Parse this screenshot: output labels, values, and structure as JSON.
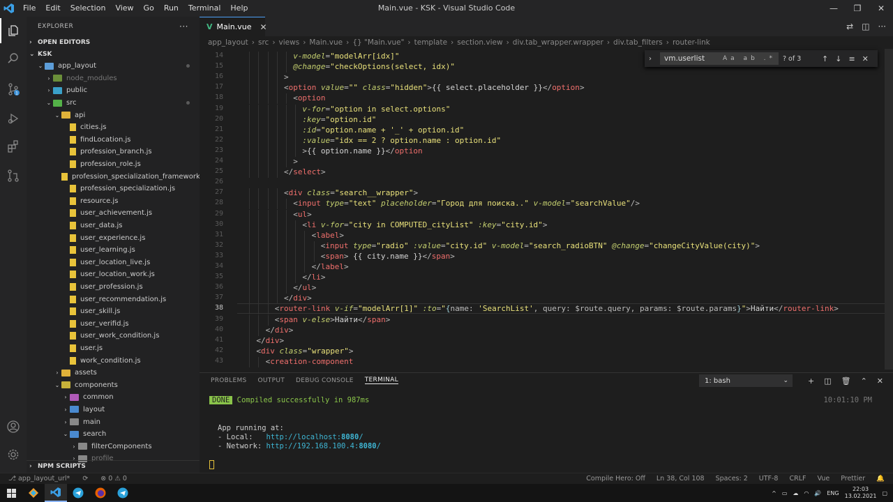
{
  "titlebar": {
    "menu": [
      "File",
      "Edit",
      "Selection",
      "View",
      "Go",
      "Run",
      "Terminal",
      "Help"
    ],
    "title": "Main.vue - KSK - Visual Studio Code"
  },
  "sidebar": {
    "header": "EXPLORER",
    "more": "···",
    "open_editors": "OPEN EDITORS",
    "project": "KSK",
    "npm_scripts": "NPM SCRIPTS",
    "tree": [
      {
        "label": "app_layout",
        "depth": 1,
        "type": "folder-open",
        "color": "#5d9dd8",
        "dot": true
      },
      {
        "label": "node_modules",
        "depth": 2,
        "type": "folder",
        "color": "#6b8f3a",
        "dim": true
      },
      {
        "label": "public",
        "depth": 2,
        "type": "folder",
        "color": "#3aa0c8"
      },
      {
        "label": "src",
        "depth": 2,
        "type": "folder-open",
        "color": "#54b248",
        "dot": true
      },
      {
        "label": "api",
        "depth": 3,
        "type": "folder-open",
        "color": "#e0b23a"
      },
      {
        "label": "cities.js",
        "depth": 4,
        "type": "js"
      },
      {
        "label": "findLocation.js",
        "depth": 4,
        "type": "js"
      },
      {
        "label": "profession_branch.js",
        "depth": 4,
        "type": "js"
      },
      {
        "label": "profession_role.js",
        "depth": 4,
        "type": "js"
      },
      {
        "label": "profession_specialization_framework.js",
        "depth": 4,
        "type": "js"
      },
      {
        "label": "profession_specialization.js",
        "depth": 4,
        "type": "js"
      },
      {
        "label": "resource.js",
        "depth": 4,
        "type": "js"
      },
      {
        "label": "user_achievement.js",
        "depth": 4,
        "type": "js"
      },
      {
        "label": "user_data.js",
        "depth": 4,
        "type": "js"
      },
      {
        "label": "user_experience.js",
        "depth": 4,
        "type": "js"
      },
      {
        "label": "user_learning.js",
        "depth": 4,
        "type": "js"
      },
      {
        "label": "user_location_live.js",
        "depth": 4,
        "type": "js"
      },
      {
        "label": "user_location_work.js",
        "depth": 4,
        "type": "js"
      },
      {
        "label": "user_profession.js",
        "depth": 4,
        "type": "js"
      },
      {
        "label": "user_recommendation.js",
        "depth": 4,
        "type": "js"
      },
      {
        "label": "user_skill.js",
        "depth": 4,
        "type": "js"
      },
      {
        "label": "user_verifid.js",
        "depth": 4,
        "type": "js"
      },
      {
        "label": "user_work_condition.js",
        "depth": 4,
        "type": "js"
      },
      {
        "label": "user.js",
        "depth": 4,
        "type": "js"
      },
      {
        "label": "work_condition.js",
        "depth": 4,
        "type": "js"
      },
      {
        "label": "assets",
        "depth": 3,
        "type": "folder",
        "color": "#e0b23a"
      },
      {
        "label": "components",
        "depth": 3,
        "type": "folder-open",
        "color": "#c7b23a"
      },
      {
        "label": "common",
        "depth": 4,
        "type": "folder",
        "color": "#b05ab8"
      },
      {
        "label": "layout",
        "depth": 4,
        "type": "folder",
        "color": "#4a8ad0"
      },
      {
        "label": "main",
        "depth": 4,
        "type": "folder",
        "color": "#888"
      },
      {
        "label": "search",
        "depth": 4,
        "type": "folder-open",
        "color": "#4a8ad0"
      },
      {
        "label": "filterComponents",
        "depth": 5,
        "type": "folder",
        "color": "#888"
      },
      {
        "label": "profile",
        "depth": 5,
        "type": "folder",
        "color": "#888",
        "dim": true
      }
    ]
  },
  "tab": {
    "label": "Main.vue",
    "close": "✕"
  },
  "breadcrumb": [
    "app_layout",
    "src",
    "views",
    "Main.vue",
    "{} \"Main.vue\"",
    "template",
    "section.view",
    "div.tab_wrapper.wrapper",
    "div.tab_filters",
    "router-link"
  ],
  "find": {
    "query": "vm.userlist",
    "count": "? of 3",
    "options": "Aa ab .*"
  },
  "code": {
    "current_line": "38",
    "lines": [
      {
        "n": "14",
        "indent": 6,
        "html": "<span class='a'>v-model</span><span class='p'>=</span><span class='s'>\"modelArr[idx]\"</span>"
      },
      {
        "n": "15",
        "indent": 6,
        "html": "<span class='a'>@change</span><span class='p'>=</span><span class='s'>\"checkOptions(select, idx)\"</span>"
      },
      {
        "n": "16",
        "indent": 5,
        "html": "<span class='p'>&gt;</span>"
      },
      {
        "n": "17",
        "indent": 5,
        "html": "<span class='p'>&lt;</span><span class='t'>option</span> <span class='a'>value</span><span class='p'>=</span><span class='s'>\"\"</span> <span class='a'>class</span><span class='p'>=</span><span class='s'>\"hidden\"</span><span class='p'>&gt;</span>{{ select.placeholder }}<span class='p'>&lt;/</span><span class='t'>option</span><span class='p'>&gt;</span>"
      },
      {
        "n": "18",
        "indent": 6,
        "html": "<span class='p'>&lt;</span><span class='t'>option</span>"
      },
      {
        "n": "19",
        "indent": 7,
        "html": "<span class='a'>v-for</span><span class='p'>=</span><span class='s'>\"option in select.options\"</span>"
      },
      {
        "n": "20",
        "indent": 7,
        "html": "<span class='a'>:key</span><span class='p'>=</span><span class='s'>\"option.id\"</span>"
      },
      {
        "n": "21",
        "indent": 7,
        "html": "<span class='a'>:id</span><span class='p'>=</span><span class='s'>\"option.name + '_' + option.id\"</span>"
      },
      {
        "n": "22",
        "indent": 7,
        "html": "<span class='a'>:value</span><span class='p'>=</span><span class='s'>\"idx == 2 ? option.name : option.id\"</span>"
      },
      {
        "n": "23",
        "indent": 7,
        "html": "<span class='p'>&gt;</span>{{ option.name }}<span class='p'>&lt;/</span><span class='t'>option</span>"
      },
      {
        "n": "24",
        "indent": 6,
        "html": "<span class='p'>&gt;</span>"
      },
      {
        "n": "25",
        "indent": 5,
        "html": "<span class='p'>&lt;/</span><span class='t'>select</span><span class='p'>&gt;</span>"
      },
      {
        "n": "26",
        "indent": 0,
        "html": ""
      },
      {
        "n": "27",
        "indent": 5,
        "html": "<span class='p'>&lt;</span><span class='t'>div</span> <span class='a'>class</span><span class='p'>=</span><span class='s'>\"search__wrapper\"</span><span class='p'>&gt;</span>"
      },
      {
        "n": "28",
        "indent": 6,
        "html": "<span class='p'>&lt;</span><span class='t'>input</span> <span class='a'>type</span><span class='p'>=</span><span class='s'>\"text\"</span> <span class='a'>placeholder</span><span class='p'>=</span><span class='s'>\"Город для поиска..\"</span> <span class='a'>v-model</span><span class='p'>=</span><span class='s'>\"searchValue\"</span><span class='p'>/&gt;</span>"
      },
      {
        "n": "29",
        "indent": 6,
        "html": "<span class='p'>&lt;</span><span class='t'>ul</span><span class='p'>&gt;</span>"
      },
      {
        "n": "30",
        "indent": 7,
        "html": "<span class='p'>&lt;</span><span class='t'>li</span> <span class='a'>v-for</span><span class='p'>=</span><span class='s'>\"city in COMPUTED_cityList\"</span> <span class='a'>:key</span><span class='p'>=</span><span class='s'>\"city.id\"</span><span class='p'>&gt;</span>"
      },
      {
        "n": "31",
        "indent": 8,
        "html": "<span class='p'>&lt;</span><span class='t'>label</span><span class='p'>&gt;</span>"
      },
      {
        "n": "32",
        "indent": 9,
        "html": "<span class='p'>&lt;</span><span class='t'>input</span> <span class='a'>type</span><span class='p'>=</span><span class='s'>\"radio\"</span> <span class='a'>:value</span><span class='p'>=</span><span class='s'>\"city.id\"</span> <span class='a'>v-model</span><span class='p'>=</span><span class='s'>\"search_radioBTN\"</span> <span class='a'>@change</span><span class='p'>=</span><span class='s'>\"changeCityValue(city)\"</span><span class='p'>&gt;</span>"
      },
      {
        "n": "33",
        "indent": 9,
        "html": "<span class='p'>&lt;</span><span class='t'>span</span><span class='p'>&gt;</span> {{ city.name }}<span class='p'>&lt;/</span><span class='t'>span</span><span class='p'>&gt;</span>"
      },
      {
        "n": "34",
        "indent": 8,
        "html": "<span class='p'>&lt;/</span><span class='t'>label</span><span class='p'>&gt;</span>"
      },
      {
        "n": "35",
        "indent": 7,
        "html": "<span class='p'>&lt;/</span><span class='t'>li</span><span class='p'>&gt;</span>"
      },
      {
        "n": "36",
        "indent": 6,
        "html": "<span class='p'>&lt;/</span><span class='t'>ul</span><span class='p'>&gt;</span>"
      },
      {
        "n": "37",
        "indent": 5,
        "html": "<span class='p'>&lt;/</span><span class='t'>div</span><span class='p'>&gt;</span>"
      },
      {
        "n": "38",
        "indent": 4,
        "html": "<span class='p'>&lt;</span><span class='t'>router-link</span> <span class='a'>v-if</span><span class='p'>=</span><span class='s'>\"modelArr[1]\"</span> <span class='a'>:to</span><span class='p'>=</span><span class='s'>\"</span><span class='g'>{</span><span class='p'>name: </span><span class='s'>'SearchList'</span><span class='p'>, query: $route.query, params: $route.params</span><span class='g'>}</span><span class='s'>\"</span><span class='p'>&gt;</span>Найти<span class='p'>&lt;/</span><span class='t'>router-link</span><span class='p'>&gt;</span>"
      },
      {
        "n": "39",
        "indent": 4,
        "html": "<span class='p'>&lt;</span><span class='t'>span</span> <span class='a'>v-else</span><span class='p'>&gt;</span>Найти<span class='p'>&lt;/</span><span class='t'>span</span><span class='p'>&gt;</span>"
      },
      {
        "n": "40",
        "indent": 3,
        "html": "<span class='p'>&lt;/</span><span class='t'>div</span><span class='p'>&gt;</span>"
      },
      {
        "n": "41",
        "indent": 2,
        "html": "<span class='p'>&lt;/</span><span class='t'>div</span><span class='p'>&gt;</span>"
      },
      {
        "n": "42",
        "indent": 2,
        "html": "<span class='p'>&lt;</span><span class='t'>div</span> <span class='a'>class</span><span class='p'>=</span><span class='s'>\"wrapper\"</span><span class='p'>&gt;</span>"
      },
      {
        "n": "43",
        "indent": 3,
        "html": "<span class='p'>&lt;</span><span class='t'>creation-component</span>"
      }
    ]
  },
  "panel": {
    "tabs": [
      "PROBLEMS",
      "OUTPUT",
      "DEBUG CONSOLE",
      "TERMINAL"
    ],
    "active_tab": "TERMINAL",
    "shell": "1: bash"
  },
  "terminal": {
    "done_badge": "DONE",
    "compiled": "Compiled successfully in 987ms",
    "time": "10:01:10 PM",
    "running": "App running at:",
    "local_label": "- Local:   ",
    "local_url": "http://localhost:",
    "local_port": "8080",
    "network_label": "- Network: ",
    "network_url": "http://192.168.100.4:",
    "network_port": "8080"
  },
  "status": {
    "branch": "app_layout_url*",
    "problems": "⊗ 0 ⚠ 0",
    "compile_hero": "Compile Hero: Off",
    "position": "Ln 38, Col 108",
    "spaces": "Spaces: 2",
    "encoding": "UTF-8",
    "eol": "CRLF",
    "language": "Vue",
    "formatter": "Prettier"
  },
  "taskbar": {
    "lang": "ENG",
    "time": "22:03",
    "date": "13.02.2021"
  }
}
